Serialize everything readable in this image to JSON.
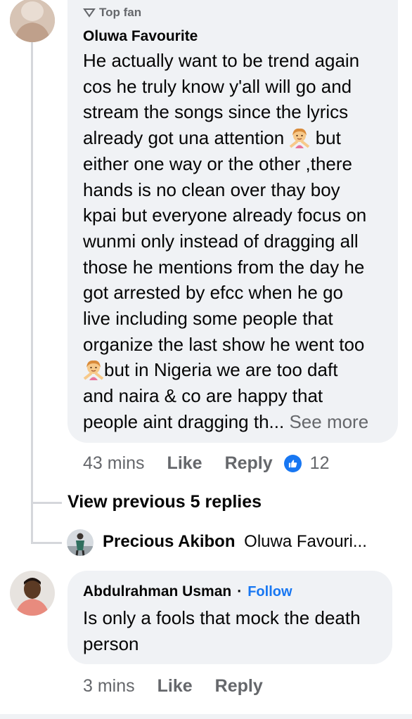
{
  "comment1": {
    "badge": "Top fan",
    "author": "Oluwa Favourite",
    "lines": [
      "He actually want to be trend again",
      "cos he truly know y'all will go and",
      "stream the songs since the lyrics",
      "already got una attention",
      "either one way or the other ,there",
      "hands is no clean over thay boy",
      "kpai but everyone already focus on",
      "wunmi only instead of dragging all",
      "those he mentions from the day he",
      "got arrested by efcc when he go",
      "live including some people that",
      "organize the last show he went too",
      "but in Nigeria we are too daft",
      "and naira & co are happy that",
      "people aint dragging th..."
    ],
    "line4_suffix": "but",
    "see_more": "See more",
    "time": "43 mins",
    "like_label": "Like",
    "reply_label": "Reply",
    "reaction_count": "12"
  },
  "thread": {
    "view_previous": "View previous 5 replies",
    "reply_author": "Precious Akibon",
    "reply_preview": "Oluwa Favouri..."
  },
  "comment2": {
    "author": "Abdulrahman Usman",
    "dot": "·",
    "follow_label": "Follow",
    "lines": [
      "Is only a fools that mock the death",
      "person"
    ],
    "time": "3 mins",
    "like_label": "Like",
    "reply_label": "Reply"
  },
  "colors": {
    "bubble": "#f0f2f5",
    "secondary_text": "#65676b",
    "accent": "#1877f2"
  }
}
